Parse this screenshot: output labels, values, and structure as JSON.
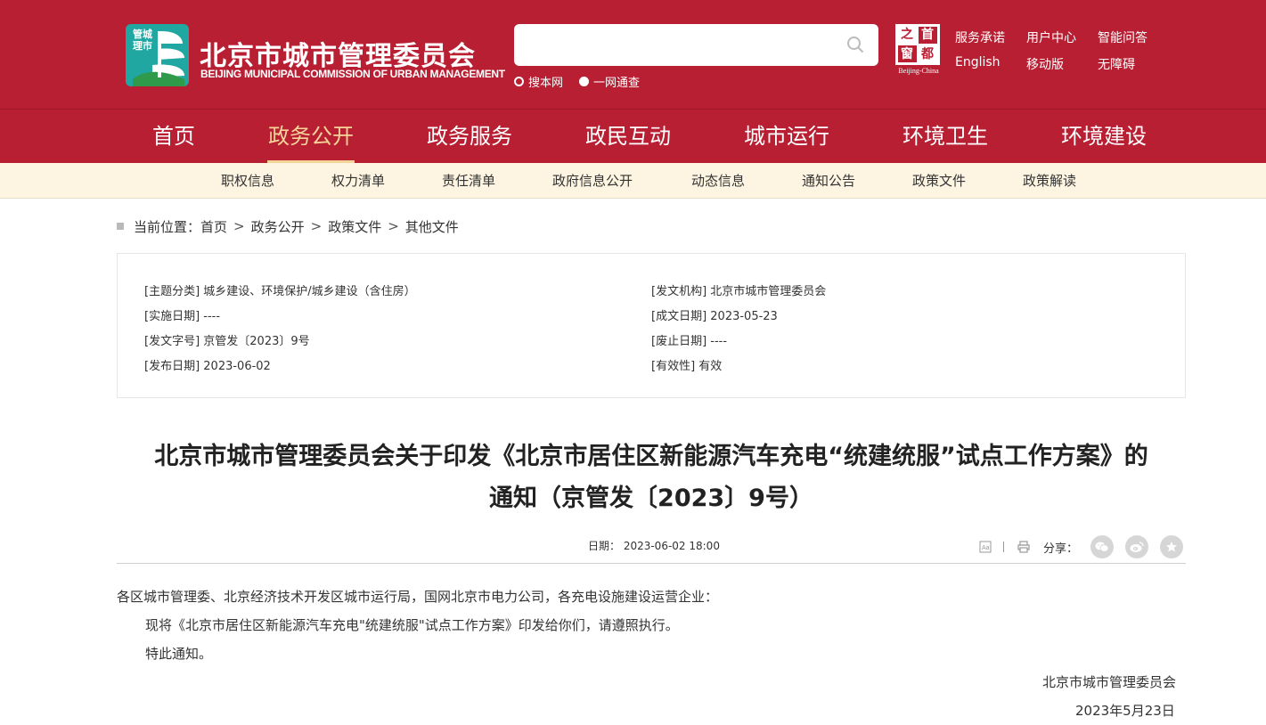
{
  "header": {
    "logo_badge_text": "管城理市",
    "site_name": "北京市城市管理委员会",
    "site_name_en": "BEIJING MUNICIPAL COMMISSION OF URBAN MANAGEMENT",
    "search": {
      "placeholder": "",
      "value": ""
    },
    "search_scopes": [
      {
        "label": "搜本网",
        "selected": true
      },
      {
        "label": "一网通查",
        "selected": false
      }
    ],
    "capital_logo": {
      "chars": [
        "之",
        "首",
        "窗",
        "都"
      ],
      "caption": "Beijing-China"
    },
    "links": [
      "服务承诺",
      "用户中心",
      "智能问答",
      "English",
      "移动版",
      "无障碍"
    ]
  },
  "main_nav": {
    "items": [
      "首页",
      "政务公开",
      "政务服务",
      "政民互动",
      "城市运行",
      "环境卫生",
      "环境建设"
    ],
    "active": "政务公开"
  },
  "sub_nav": {
    "items": [
      "职权信息",
      "权力清单",
      "责任清单",
      "政府信息公开",
      "动态信息",
      "通知公告",
      "政策文件",
      "政策解读"
    ]
  },
  "breadcrumb": {
    "label": "当前位置：",
    "items": [
      "首页",
      "政务公开",
      "政策文件",
      "其他文件"
    ],
    "separator": ">"
  },
  "meta": {
    "subject": "[主题分类] 城乡建设、环境保护/城乡建设（含住房）",
    "issuer": "[发文机构] 北京市城市管理委员会",
    "effective_date": "[实施日期] ----",
    "written_date": "[成文日期] 2023-05-23",
    "doc_number": "[发文字号] 京管发〔2023〕9号",
    "repeal_date": "[废止日期] ----",
    "publish_date": "[发布日期] 2023-06-02",
    "validity": "[有效性] 有效"
  },
  "article": {
    "title_line1": "北京市城市管理委员会关于印发《北京市居住区新能源汽车充电“统建统服”试点工作方案》的",
    "title_line2": "通知（京管发〔2023〕9号）",
    "date_line": "日期：  2023-06-02 18:00",
    "share_label": "分享：",
    "share_icons": [
      "wechat-icon",
      "weibo-icon",
      "favorite-star-icon"
    ],
    "salutation": "各区城市管理委、北京经济技术开发区城市运行局，国网北京市电力公司，各充电设施建设运营企业：",
    "paragraph1": "现将《北京市居住区新能源汽车充电\"统建统服\"试点工作方案》印发给你们，请遵照执行。",
    "paragraph2": "特此通知。",
    "signature": "北京市城市管理委员会",
    "sign_date": "2023年5月23日"
  },
  "colors": {
    "brand_red": "#b91f33",
    "active_gold": "#f5d49a",
    "subnav_bg": "#fdf4e1",
    "logo_teal": "#21a7a2"
  }
}
